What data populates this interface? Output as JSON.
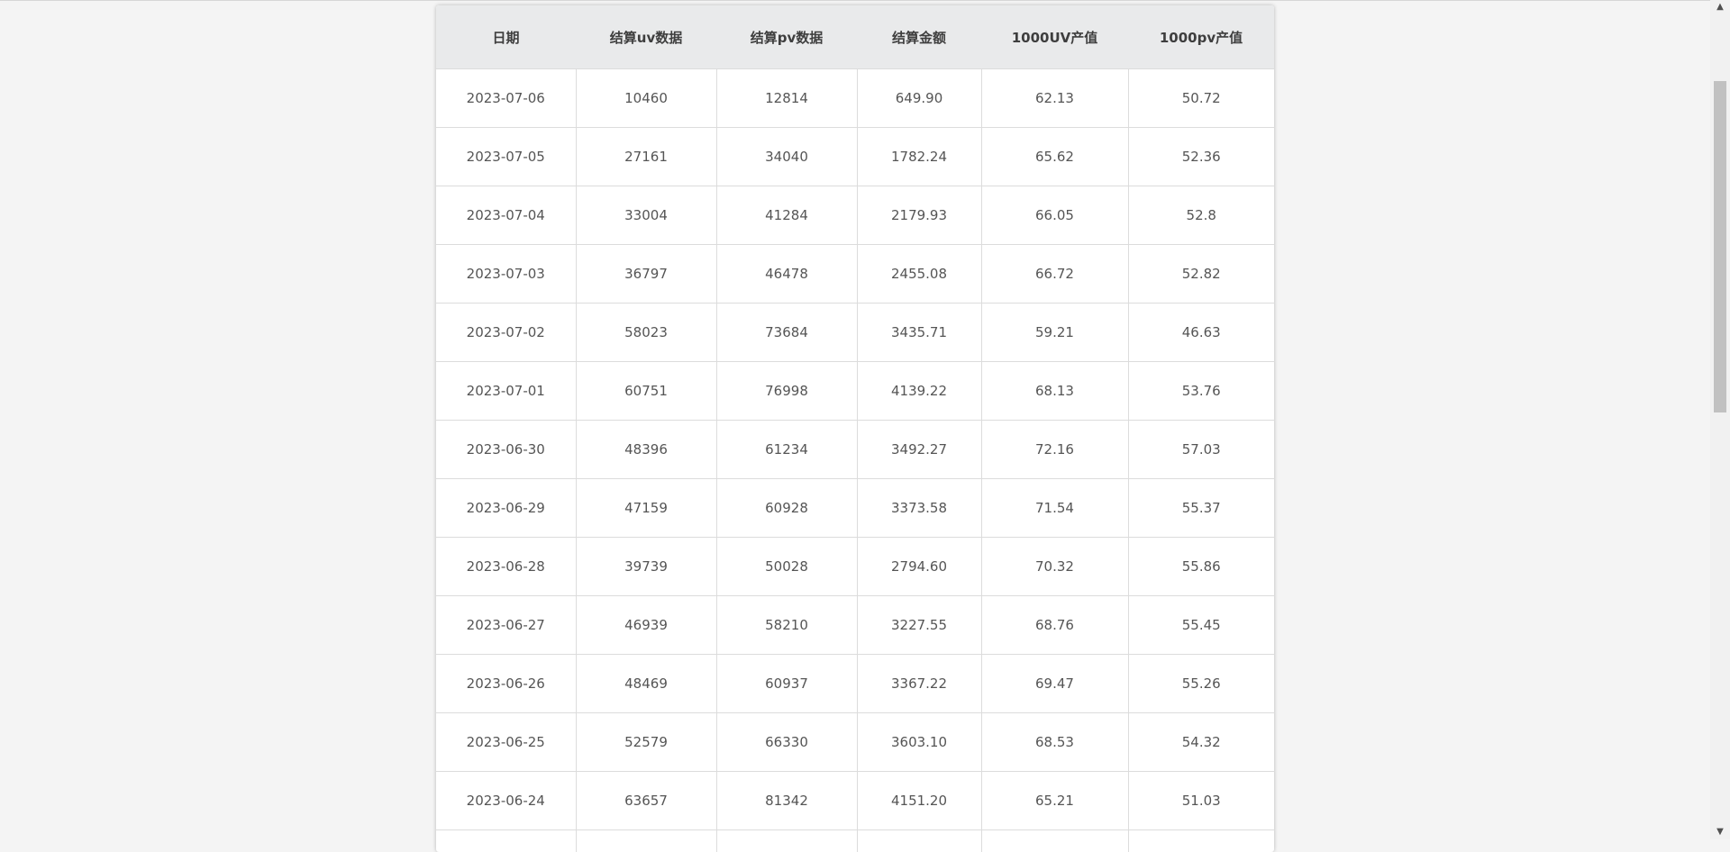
{
  "table": {
    "headers": [
      "日期",
      "结算uv数据",
      "结算pv数据",
      "结算金额",
      "1000UV产值",
      "1000pv产值"
    ],
    "rows": [
      [
        "2023-07-06",
        "10460",
        "12814",
        "649.90",
        "62.13",
        "50.72"
      ],
      [
        "2023-07-05",
        "27161",
        "34040",
        "1782.24",
        "65.62",
        "52.36"
      ],
      [
        "2023-07-04",
        "33004",
        "41284",
        "2179.93",
        "66.05",
        "52.8"
      ],
      [
        "2023-07-03",
        "36797",
        "46478",
        "2455.08",
        "66.72",
        "52.82"
      ],
      [
        "2023-07-02",
        "58023",
        "73684",
        "3435.71",
        "59.21",
        "46.63"
      ],
      [
        "2023-07-01",
        "60751",
        "76998",
        "4139.22",
        "68.13",
        "53.76"
      ],
      [
        "2023-06-30",
        "48396",
        "61234",
        "3492.27",
        "72.16",
        "57.03"
      ],
      [
        "2023-06-29",
        "47159",
        "60928",
        "3373.58",
        "71.54",
        "55.37"
      ],
      [
        "2023-06-28",
        "39739",
        "50028",
        "2794.60",
        "70.32",
        "55.86"
      ],
      [
        "2023-06-27",
        "46939",
        "58210",
        "3227.55",
        "68.76",
        "55.45"
      ],
      [
        "2023-06-26",
        "48469",
        "60937",
        "3367.22",
        "69.47",
        "55.26"
      ],
      [
        "2023-06-25",
        "52579",
        "66330",
        "3603.10",
        "68.53",
        "54.32"
      ],
      [
        "2023-06-24",
        "63657",
        "81342",
        "4151.20",
        "65.21",
        "51.03"
      ],
      [
        "",
        "",
        "",
        "",
        "",
        ""
      ]
    ]
  },
  "scrollbar": {
    "up_icon": "▲",
    "down_icon": "▼"
  }
}
